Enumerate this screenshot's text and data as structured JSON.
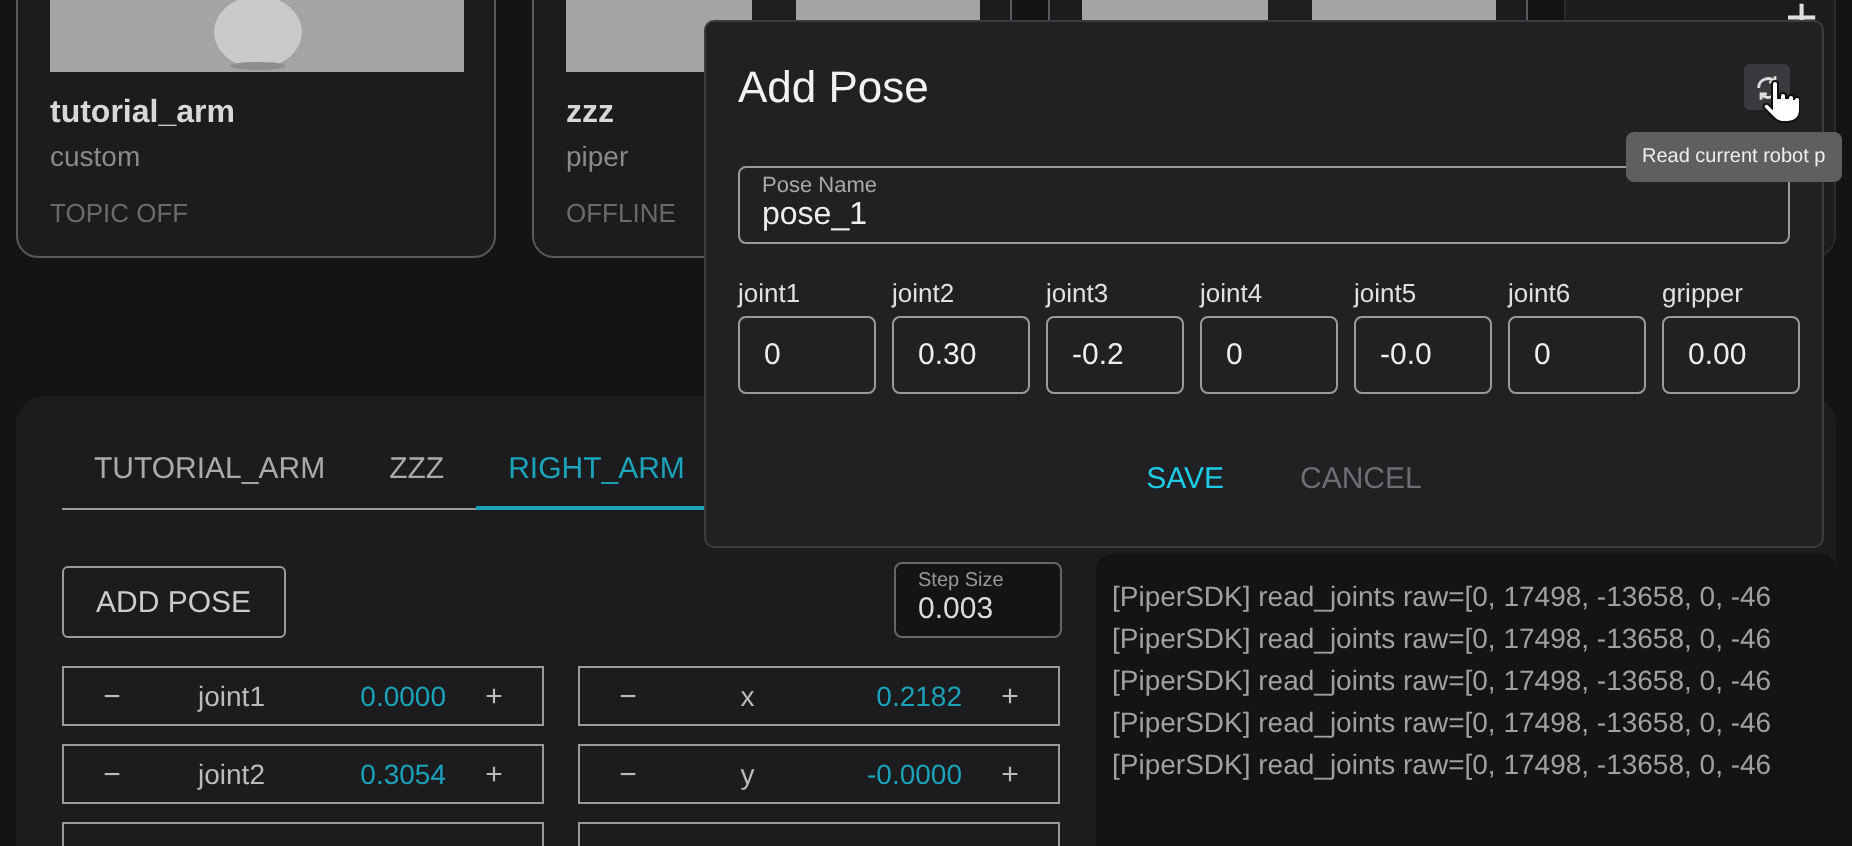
{
  "robots": [
    {
      "kind": "robot",
      "name": "tutorial_arm",
      "type": "custom",
      "status": "TOPIC OFF"
    },
    {
      "kind": "robot",
      "name": "zzz",
      "type": "piper",
      "status": "OFFLINE"
    },
    {
      "kind": "robot"
    },
    {
      "kind": "add",
      "symbol": "+"
    }
  ],
  "panel": {
    "tabs": [
      {
        "label": "TUTORIAL_ARM",
        "selected": false
      },
      {
        "label": "ZZZ",
        "selected": false
      },
      {
        "label": "RIGHT_ARM",
        "selected": true
      }
    ],
    "add_pose": "ADD POSE",
    "step_size": {
      "label": "Step Size",
      "value": "0.003"
    },
    "joint_rows": [
      {
        "label": "joint1",
        "value": "0.0000"
      },
      {
        "label": "joint2",
        "value": "0.3054"
      },
      {}
    ],
    "cartesian_rows": [
      {
        "label": "x",
        "value": "0.2182"
      },
      {
        "label": "y",
        "value": "-0.0000"
      },
      {}
    ],
    "decrement": "−",
    "increment": "+",
    "log": [
      "[PiperSDK] read_joints raw=[0, 17498, -13658, 0, -46",
      "[PiperSDK] read_joints raw=[0, 17498, -13658, 0, -46",
      "[PiperSDK] read_joints raw=[0, 17498, -13658, 0, -46",
      "[PiperSDK] read_joints raw=[0, 17498, -13658, 0, -46",
      "[PiperSDK] read_joints raw=[0, 17498, -13658, 0, -46"
    ]
  },
  "dialog": {
    "title": "Add Pose",
    "pose_name": {
      "label": "Pose Name",
      "value": "pose_1"
    },
    "fields": [
      {
        "label": "joint1",
        "value": "0"
      },
      {
        "label": "joint2",
        "value": "0.30"
      },
      {
        "label": "joint3",
        "value": "-0.2"
      },
      {
        "label": "joint4",
        "value": "0"
      },
      {
        "label": "joint5",
        "value": "-0.0"
      },
      {
        "label": "joint6",
        "value": "0"
      },
      {
        "label": "gripper",
        "value": "0.00"
      }
    ],
    "buttons": [
      {
        "label": "SAVE",
        "primary": true
      },
      {
        "label": "CANCEL",
        "primary": false
      }
    ],
    "tooltip": "Read current robot p"
  }
}
